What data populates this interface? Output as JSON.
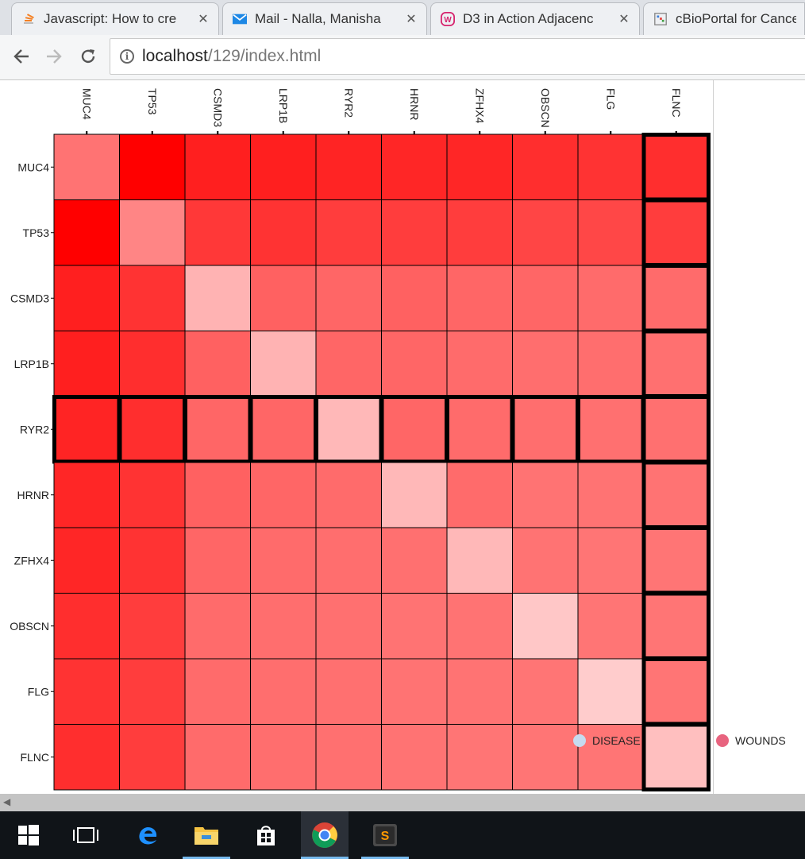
{
  "browser": {
    "tabs": [
      {
        "title": "Javascript: How to cre",
        "icon": "stackoverflow-icon"
      },
      {
        "title": "Mail - Nalla, Manisha",
        "icon": "mail-icon"
      },
      {
        "title": "D3 in Action Adjacenc",
        "icon": "website-icon"
      },
      {
        "title": "cBioPortal for Cancer",
        "icon": "cbioportal-icon"
      }
    ],
    "close_glyph": "✕",
    "url_host": "localhost",
    "url_path": "/129/index.html"
  },
  "chart_data": {
    "type": "heatmap",
    "title": "",
    "columns": [
      "MUC4",
      "TP53",
      "CSMD3",
      "LRP1B",
      "RYR2",
      "HRNR",
      "ZFHX4",
      "OBSCN",
      "FLG",
      "FLNC"
    ],
    "rows": [
      "MUC4",
      "TP53",
      "CSMD3",
      "LRP1B",
      "RYR2",
      "HRNR",
      "ZFHX4",
      "OBSCN",
      "FLG",
      "FLNC"
    ],
    "values": [
      [
        0.55,
        1.0,
        0.88,
        0.88,
        0.86,
        0.85,
        0.85,
        0.82,
        0.8,
        0.82
      ],
      [
        1.0,
        0.48,
        0.78,
        0.8,
        0.76,
        0.76,
        0.76,
        0.73,
        0.72,
        0.76
      ],
      [
        0.88,
        0.8,
        0.3,
        0.62,
        0.6,
        0.62,
        0.6,
        0.6,
        0.58,
        0.58
      ],
      [
        0.88,
        0.82,
        0.62,
        0.3,
        0.6,
        0.6,
        0.58,
        0.57,
        0.57,
        0.56
      ],
      [
        0.86,
        0.82,
        0.6,
        0.6,
        0.28,
        0.6,
        0.58,
        0.57,
        0.56,
        0.56
      ],
      [
        0.85,
        0.8,
        0.62,
        0.6,
        0.58,
        0.28,
        0.58,
        0.55,
        0.55,
        0.55
      ],
      [
        0.85,
        0.8,
        0.6,
        0.58,
        0.57,
        0.56,
        0.28,
        0.55,
        0.54,
        0.54
      ],
      [
        0.82,
        0.76,
        0.58,
        0.57,
        0.56,
        0.55,
        0.55,
        0.22,
        0.54,
        0.54
      ],
      [
        0.8,
        0.76,
        0.58,
        0.57,
        0.56,
        0.55,
        0.55,
        0.54,
        0.2,
        0.54
      ],
      [
        0.82,
        0.76,
        0.58,
        0.57,
        0.56,
        0.55,
        0.54,
        0.54,
        0.54,
        0.25
      ]
    ],
    "color_scale": {
      "low": "#ffffff",
      "high": "#ff0000"
    },
    "highlighted_row": "RYR2",
    "highlighted_column": "FLNC",
    "legend": [
      {
        "label": "DISEASE",
        "color": "#c6dbef"
      },
      {
        "label": "WOUNDS",
        "color": "#e8647f"
      }
    ]
  }
}
